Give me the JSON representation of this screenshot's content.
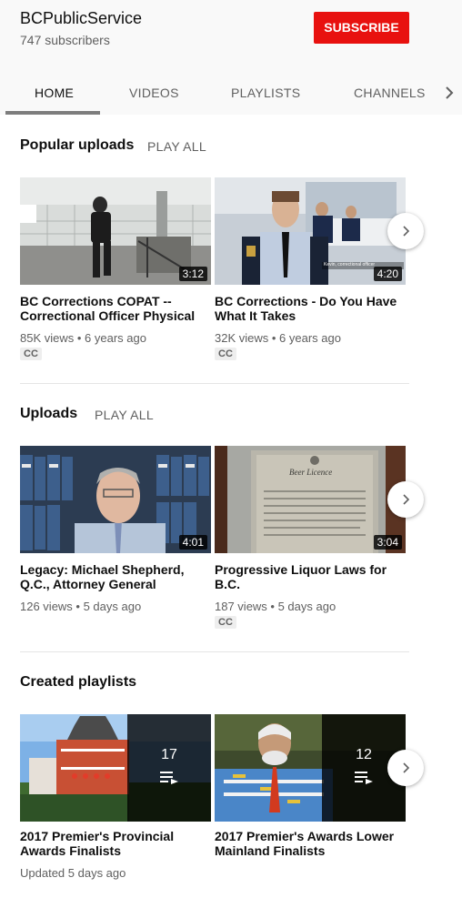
{
  "channel": {
    "name": "BCPublicService",
    "subscribers": "747 subscribers",
    "subscribe_label": "SUBSCRIBE"
  },
  "tabs": [
    {
      "label": "HOME",
      "active": true
    },
    {
      "label": "VIDEOS",
      "active": false
    },
    {
      "label": "PLAYLISTS",
      "active": false
    },
    {
      "label": "CHANNELS",
      "active": false
    }
  ],
  "popular": {
    "title": "Popular uploads",
    "play_all": "PLAY ALL",
    "videos": [
      {
        "title": "BC Corrections COPAT -- Correctional Officer Physical",
        "meta": "85K views • 6 years ago",
        "duration": "3:12",
        "cc": "CC"
      },
      {
        "title": "BC Corrections - Do You Have What It Takes",
        "meta": "32K views • 6 years ago",
        "duration": "4:20",
        "cc": "CC",
        "caption": "Kevin, correctional officer"
      }
    ]
  },
  "uploads": {
    "title": "Uploads",
    "play_all": "PLAY ALL",
    "videos": [
      {
        "title": "Legacy: Michael Shepherd, Q.C., Attorney General",
        "meta": "126 views • 5 days ago",
        "duration": "4:01"
      },
      {
        "title": "Progressive Liquor Laws for B.C.",
        "meta": "187 views • 5 days ago",
        "duration": "3:04",
        "cc": "CC",
        "caption": "Beer Licence"
      }
    ]
  },
  "playlists": {
    "title": "Created playlists",
    "items": [
      {
        "title": "2017 Premier's Provincial Awards Finalists",
        "count": "17",
        "meta": "Updated 5 days ago"
      },
      {
        "title": "2017 Premier's Awards Lower Mainland Finalists",
        "count": "12"
      }
    ]
  },
  "colors": {
    "subscribe": "#e8110f",
    "header_bg": "#f9f9f9",
    "secondary_text": "#606060"
  }
}
